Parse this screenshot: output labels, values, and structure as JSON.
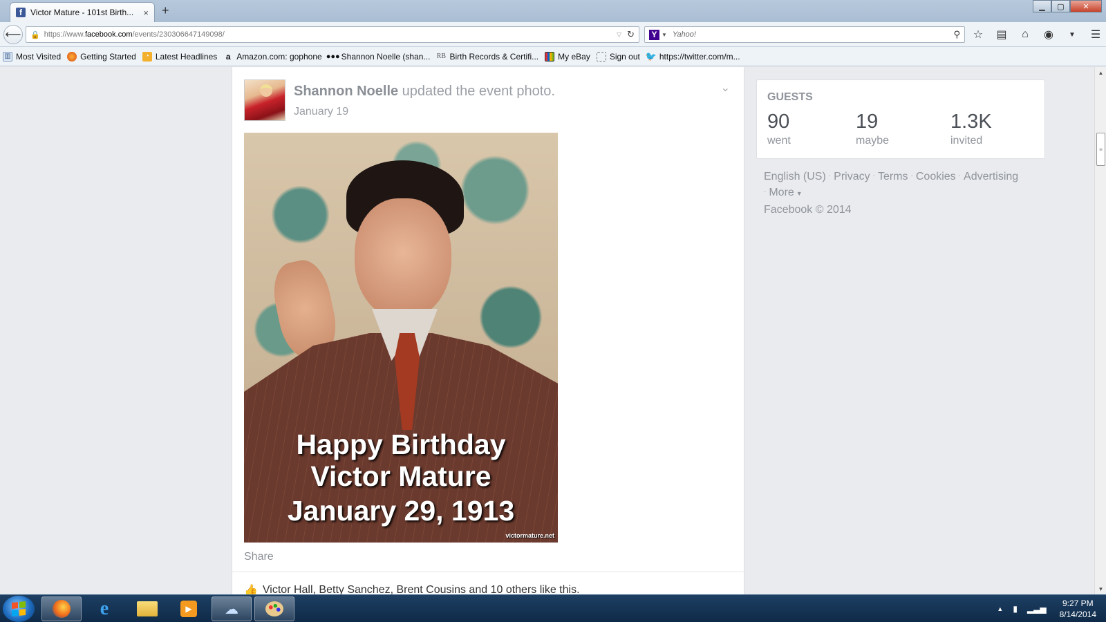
{
  "browser": {
    "tab_title": "Victor Mature - 101st Birth...",
    "tab_close": "×",
    "new_tab": "+",
    "url_scheme": "https://www.",
    "url_host": "facebook.com",
    "url_path": "/events/230306647149098/",
    "search_engine_icon": "Y",
    "search_placeholder": "Yahoo!",
    "window_buttons": {
      "minimize": "▁",
      "maximize": "▢",
      "close": "✕"
    }
  },
  "bookmarks": [
    {
      "label": "Most Visited",
      "icon": "most-visited-icon"
    },
    {
      "label": "Getting Started",
      "icon": "firefox-icon"
    },
    {
      "label": "Latest Headlines",
      "icon": "rss-icon"
    },
    {
      "label": "Amazon.com: gophone",
      "icon": "amazon-icon"
    },
    {
      "label": "Shannon Noelle (shan...",
      "icon": "myspace-icon"
    },
    {
      "label": "Birth Records & Certifi...",
      "icon": "rb-icon"
    },
    {
      "label": "My eBay",
      "icon": "ebay-icon"
    },
    {
      "label": "Sign out",
      "icon": "page-icon"
    },
    {
      "label": "https://twitter.com/m...",
      "icon": "twitter-icon"
    }
  ],
  "post": {
    "author": "Shannon Noelle",
    "action": " updated the event photo.",
    "date": "January 19",
    "photo_caption": [
      "Happy Birthday",
      "Victor Mature",
      "January 29, 1913"
    ],
    "photo_credit": "victormature.net",
    "share_label": "Share",
    "likes_text": "Victor Hall, Betty Sanchez, Brent Cousins and 10 others like this."
  },
  "guests": {
    "title": "GUESTS",
    "stats": [
      {
        "number": "90",
        "label": "went"
      },
      {
        "number": "19",
        "label": "maybe"
      },
      {
        "number": "1.3K",
        "label": "invited"
      }
    ]
  },
  "footer": {
    "links": [
      "English (US)",
      "Privacy",
      "Terms",
      "Cookies",
      "Advertising",
      "More"
    ],
    "copyright": "Facebook © 2014"
  },
  "taskbar": {
    "time": "9:27 PM",
    "date": "8/14/2014"
  },
  "colors": {
    "facebook_blue": "#3b5998",
    "yahoo_purple": "#400090",
    "page_bg": "#e9ebee",
    "muted_text": "#90949c"
  }
}
